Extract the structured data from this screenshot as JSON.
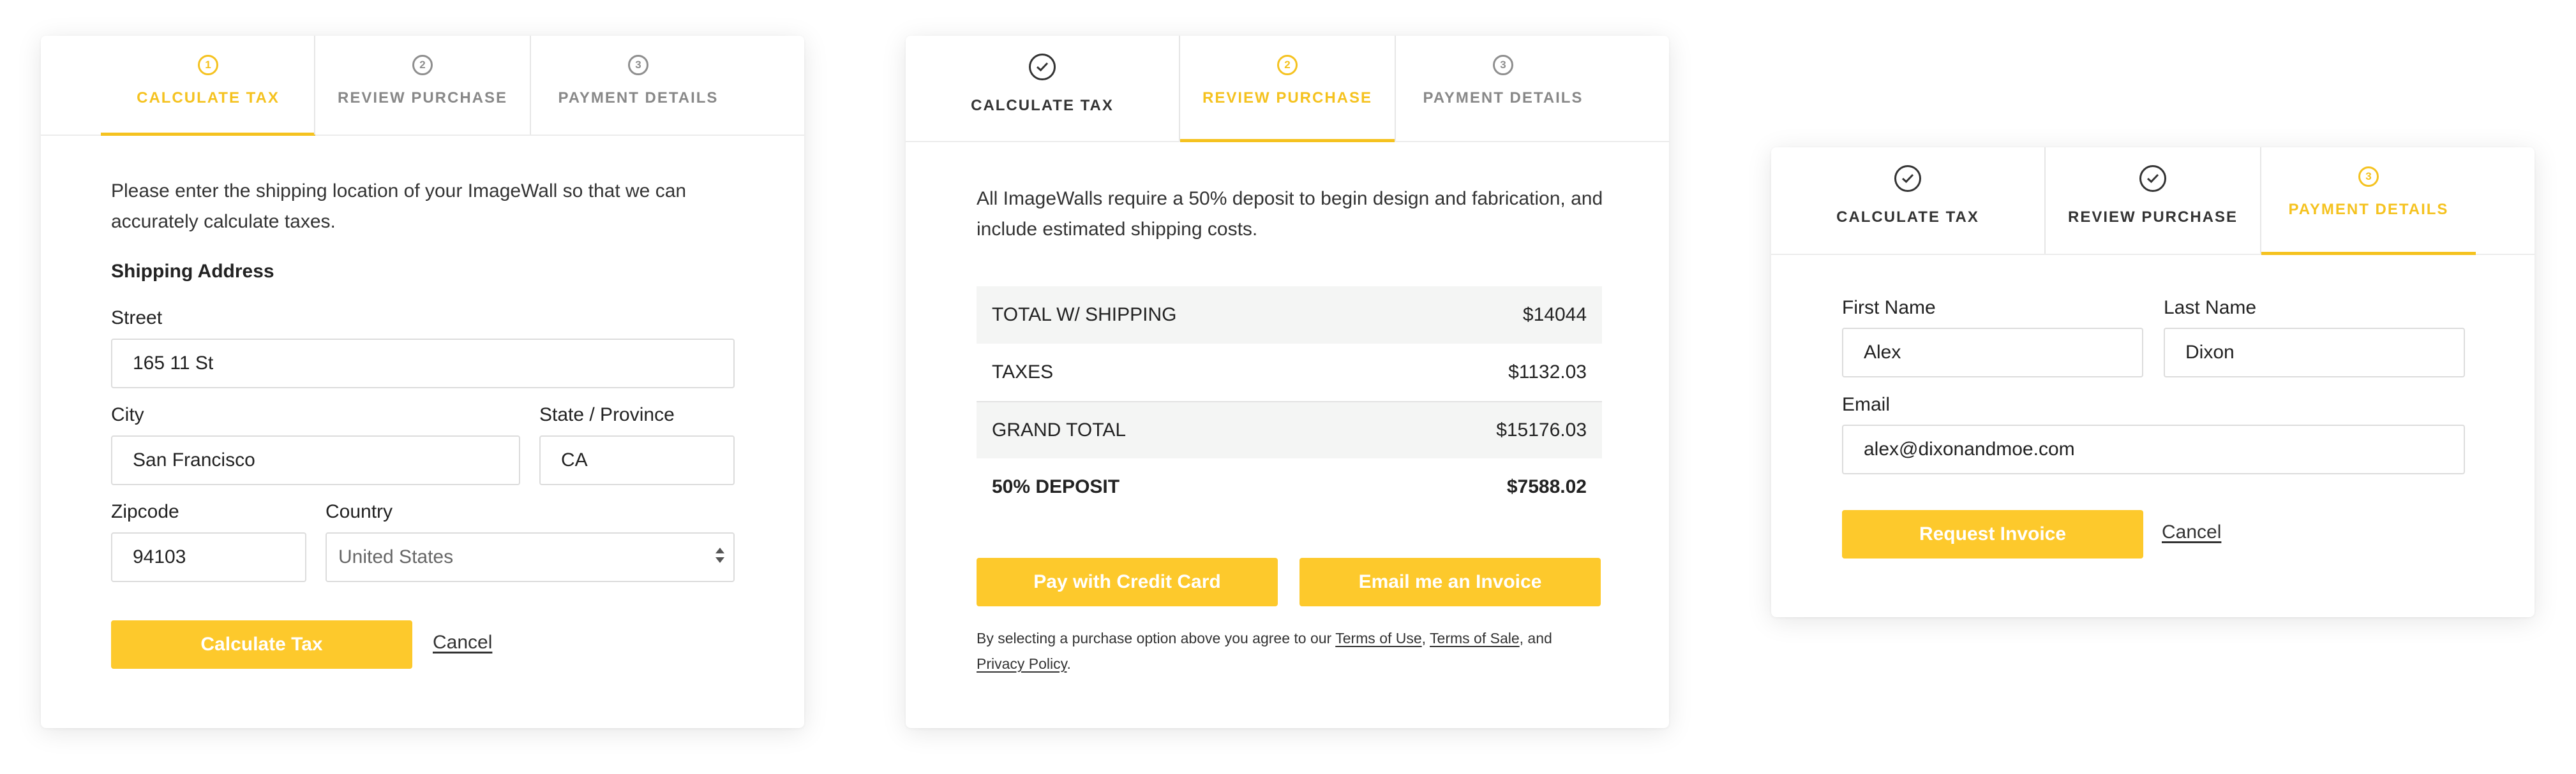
{
  "steps": {
    "calculate_tax": "CALCULATE TAX",
    "review_purchase": "REVIEW PURCHASE",
    "payment_details": "PAYMENT DETAILS",
    "num1": "1",
    "num2": "2",
    "num3": "3"
  },
  "colors": {
    "accent": "#fdc92c",
    "active_tab": "#f5c21f",
    "row_shade": "#f4f5f4"
  },
  "calculate_tax_panel": {
    "intro": "Please enter the shipping location of your ImageWall so that we can accurately calculate taxes.",
    "section_title": "Shipping Address",
    "street_label": "Street",
    "street_value": "165 11 St",
    "city_label": "City",
    "city_value": "San Francisco",
    "state_label": "State / Province",
    "state_value": "CA",
    "zip_label": "Zipcode",
    "zip_value": "94103",
    "country_label": "Country",
    "country_value": "United States",
    "submit_label": "Calculate Tax",
    "cancel_label": "Cancel"
  },
  "review_panel": {
    "intro": "All ImageWalls require a 50% deposit to begin design and fabrication, and include estimated shipping costs.",
    "rows": [
      {
        "label": "TOTAL W/ SHIPPING",
        "value": "$14044"
      },
      {
        "label": "TAXES",
        "value": "$1132.03"
      },
      {
        "label": "GRAND TOTAL",
        "value": "$15176.03"
      },
      {
        "label": "50% DEPOSIT",
        "value": "$7588.02"
      }
    ],
    "pay_card_label": "Pay with Credit Card",
    "email_invoice_label": "Email me an Invoice",
    "fine_print_before": "By selecting a purchase option above you agree to our ",
    "terms_of_use": "Terms of Use",
    "comma": ", ",
    "terms_of_sale": "Terms of Sale",
    "and": ", and",
    "privacy_policy": "Privacy Policy",
    "period": "."
  },
  "payment_panel": {
    "first_name_label": "First Name",
    "first_name_value": "Alex",
    "last_name_label": "Last Name",
    "last_name_value": "Dixon",
    "email_label": "Email",
    "email_value": "alex@dixonandmoe.com",
    "request_label": "Request Invoice",
    "cancel_label": "Cancel"
  },
  "icons": {
    "completed": "checkmark-circle-icon",
    "select": "select-arrows-icon"
  }
}
